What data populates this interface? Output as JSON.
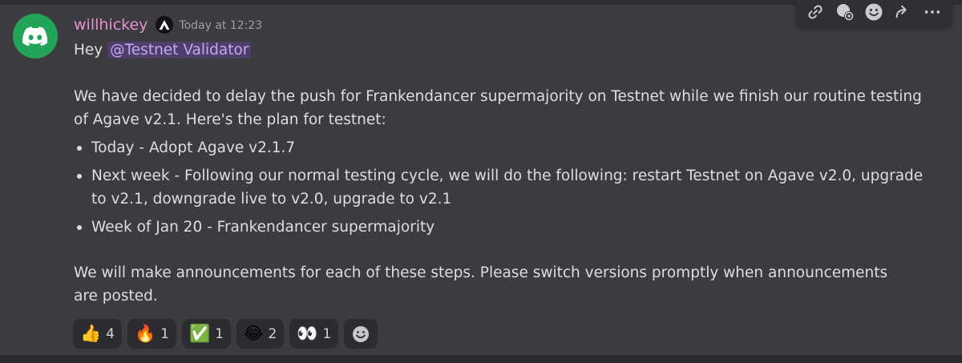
{
  "message": {
    "author": "willhickey",
    "timestamp": "Today at 12:23",
    "greeting": "Hey",
    "mention": "@Testnet Validator",
    "paragraph1": "We have decided to delay the push for Frankendancer supermajority on Testnet while we finish our routine testing",
    "paragraph1b": "of Agave v2.1. Here's the plan for testnet:",
    "plan_items": [
      "Today - Adopt Agave v2.1.7",
      "Next week - Following our normal testing cycle, we will do the following: restart Testnet on Agave v2.0, upgrade to v2.1, downgrade live to v2.0, upgrade to v2.1",
      "Week of Jan 20 - Frankendancer supermajority"
    ],
    "paragraph2": "We will make announcements for each of these steps. Please switch versions promptly when announcements are posted."
  },
  "reactions": [
    {
      "emoji": "👍",
      "name": "thumbs-up",
      "count": "4"
    },
    {
      "emoji": "🔥",
      "name": "fire",
      "count": "1"
    },
    {
      "emoji": "✅",
      "name": "check-mark",
      "count": "1"
    },
    {
      "emoji": "😂",
      "name": "laughing",
      "count": "2"
    },
    {
      "emoji": "👀",
      "name": "eyes",
      "count": "1"
    }
  ],
  "toolbar_icons": [
    "link-icon",
    "reply-thread-icon",
    "add-reaction-icon",
    "forward-icon",
    "more-icon"
  ],
  "colors": {
    "background": "#3c3b40",
    "avatar": "#23a559",
    "username": "#e88fd1",
    "mention_text": "#c9a5f5",
    "mention_bg": "#4d3f6a"
  }
}
